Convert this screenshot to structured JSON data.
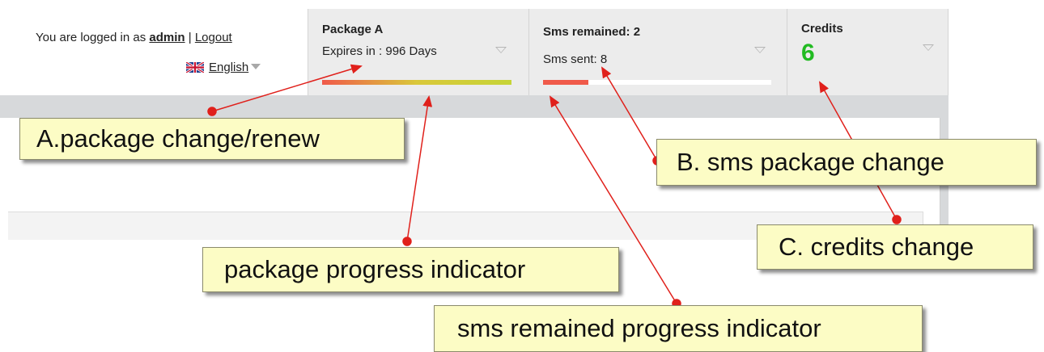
{
  "header": {
    "login_prefix": "You are logged in as",
    "username": "admin",
    "separator": "|",
    "logout_label": "Logout",
    "language_label": "English",
    "language_flag_icon": "uk-flag-icon"
  },
  "package_panel": {
    "title": "Package A",
    "subtitle": "Expires in : 996 Days",
    "progress_fraction": 1.0,
    "progress_colors": [
      "#f05a4a",
      "#d9c83a",
      "#c6d437"
    ]
  },
  "sms_panel": {
    "title": "Sms remained: 2",
    "subtitle": "Sms sent: 8",
    "progress_fraction": 0.2,
    "progress_color": "#f05a4a"
  },
  "credits_panel": {
    "title": "Credits",
    "value": "6",
    "value_color": "#22bb22"
  },
  "annotations": {
    "a": "A.package change/renew",
    "b": "B. sms package change",
    "c": "C. credits change",
    "package_progress": "package progress indicator",
    "sms_progress": "sms remained progress indicator",
    "marker_color": "#e0201b"
  }
}
